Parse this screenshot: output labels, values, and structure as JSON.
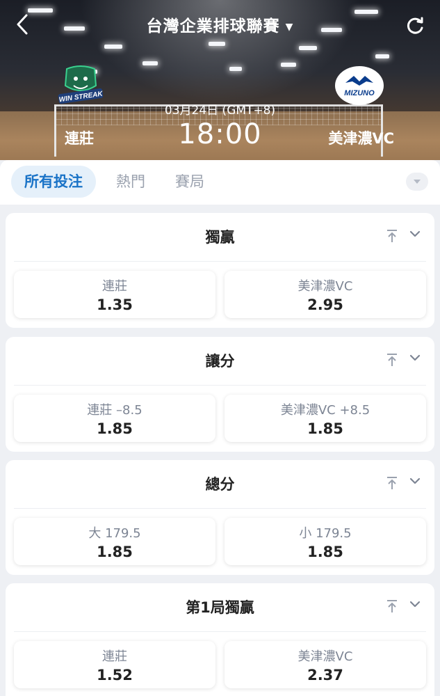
{
  "header": {
    "league_title": "台灣企業排球聯賽",
    "date": "03月24日 (GMT+8)",
    "time": "18:00",
    "home_team": "連莊",
    "away_team": "美津濃VC",
    "home_logo_text": "WIN STREAK",
    "away_logo_text": "MIZUNO",
    "icons": {
      "back": "back-chevron-icon",
      "dropdown": "caret-down-icon",
      "refresh": "refresh-icon"
    }
  },
  "tabs": {
    "items": [
      {
        "label": "所有投注",
        "active": true
      },
      {
        "label": "熱門",
        "active": false
      },
      {
        "label": "賽局",
        "active": false
      }
    ],
    "dropdown_icon": "chevron-down-icon"
  },
  "markets": [
    {
      "title": "獨贏",
      "outcomes": [
        {
          "label": "連莊",
          "odds": "1.35"
        },
        {
          "label": "美津濃VC",
          "odds": "2.95"
        }
      ]
    },
    {
      "title": "讓分",
      "outcomes": [
        {
          "label": "連莊 –8.5",
          "odds": "1.85"
        },
        {
          "label": "美津濃VC +8.5",
          "odds": "1.85"
        }
      ]
    },
    {
      "title": "總分",
      "outcomes": [
        {
          "label": "大 179.5",
          "odds": "1.85"
        },
        {
          "label": "小 179.5",
          "odds": "1.85"
        }
      ]
    },
    {
      "title": "第1局獨贏",
      "outcomes": [
        {
          "label": "連莊",
          "odds": "1.52"
        },
        {
          "label": "美津濃VC",
          "odds": "2.37"
        }
      ]
    }
  ],
  "colors": {
    "accent": "#1a73c7",
    "accent_bg": "#e5f0fa",
    "page_bg": "#eef0f4"
  }
}
